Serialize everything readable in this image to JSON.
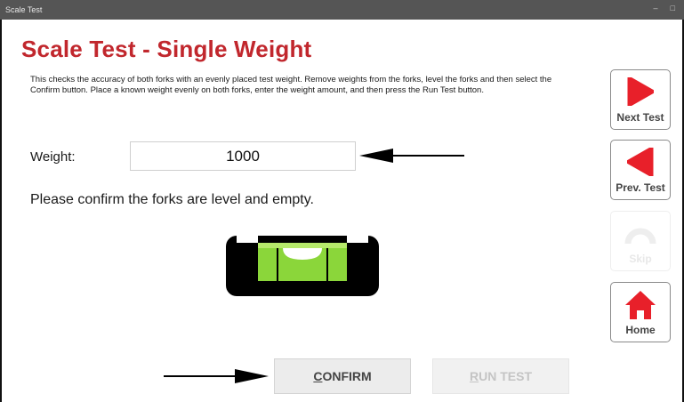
{
  "window": {
    "title": "Scale Test",
    "minimize": "–",
    "maximize": "□"
  },
  "page": {
    "title": "Scale Test - Single Weight",
    "description": "This checks the accuracy of both forks with an evenly placed test weight. Remove weights from the forks, level the forks and then select the Confirm button. Place a known weight evenly on both forks, enter the weight amount, and then press the Run Test button."
  },
  "weight": {
    "label": "Weight:",
    "value": "1000"
  },
  "confirm_message": "Please confirm the forks are level and empty.",
  "buttons": {
    "confirm_first": "C",
    "confirm_rest": "ONFIRM",
    "run_first": "R",
    "run_rest": "UN TEST"
  },
  "side_nav": {
    "next": {
      "label": "Next Test",
      "icon": "play-right-icon",
      "enabled": true
    },
    "prev": {
      "label": "Prev. Test",
      "icon": "play-left-icon",
      "enabled": true
    },
    "skip": {
      "label": "Skip",
      "icon": "skip-gauge-icon",
      "enabled": false
    },
    "home": {
      "label": "Home",
      "icon": "home-icon",
      "enabled": true
    }
  },
  "colors": {
    "accent": "#e8202a",
    "title": "#c1272d",
    "bubble": "#8bd63a"
  }
}
